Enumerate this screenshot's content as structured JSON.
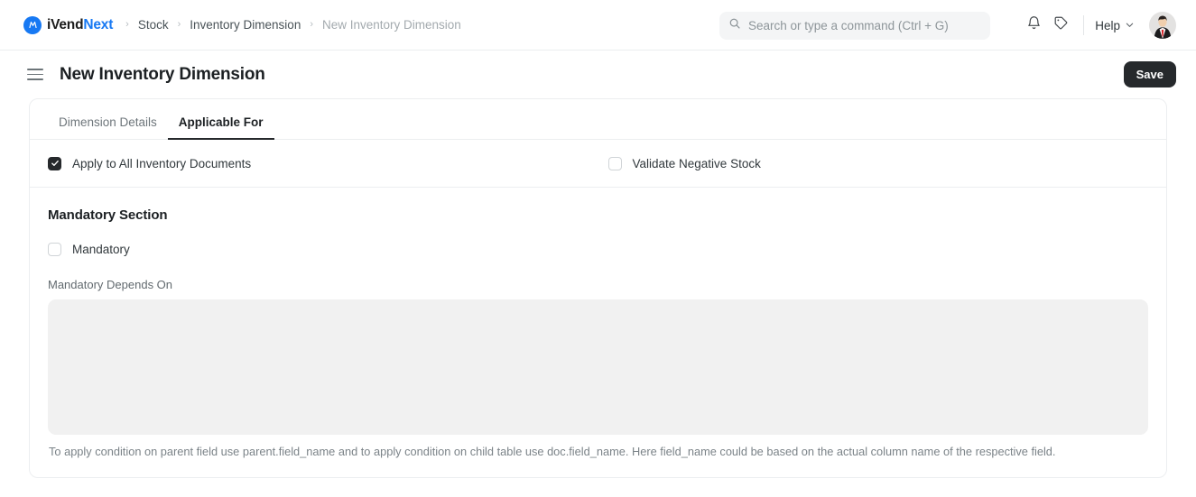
{
  "navbar": {
    "brand": {
      "name_dark": "iVend",
      "name_accent": "Next",
      "logo_icon": "ivend-circle-logo-icon"
    },
    "breadcrumbs": [
      {
        "label": "Stock",
        "current": false
      },
      {
        "label": "Inventory Dimension",
        "current": false
      },
      {
        "label": "New Inventory Dimension",
        "current": true
      }
    ],
    "separator": "›",
    "search": {
      "placeholder": "Search or type a command (Ctrl + G)",
      "value": "",
      "icon": "search-icon"
    },
    "notifications_icon": "bell-icon",
    "tags_icon": "tag-icon",
    "help": {
      "label": "Help",
      "icon": "chevron-down-icon"
    },
    "avatar_alt": "user-avatar"
  },
  "page": {
    "menu_icon": "hamburger-menu-icon",
    "title": "New Inventory Dimension",
    "save_label": "Save"
  },
  "tabs": [
    {
      "label": "Dimension Details",
      "active": false
    },
    {
      "label": "Applicable For",
      "active": true
    }
  ],
  "checkboxes": [
    {
      "label": "Apply to All Inventory Documents",
      "checked": true
    },
    {
      "label": "Validate Negative Stock",
      "checked": false
    }
  ],
  "mandatory_section": {
    "title": "Mandatory Section",
    "mandatory": {
      "label": "Mandatory",
      "checked": false
    },
    "depends_on": {
      "label": "Mandatory Depends On",
      "value": "",
      "placeholder": ""
    },
    "helper_text": "To apply condition on parent field use parent.field_name and to apply condition on child table use doc.field_name. Here field_name could be based on the actual column name of the respective field."
  },
  "colors": {
    "accent": "#1779f3",
    "button_dark": "#26292c",
    "border": "#eceef0",
    "textarea_bg": "#f1f1f1"
  }
}
